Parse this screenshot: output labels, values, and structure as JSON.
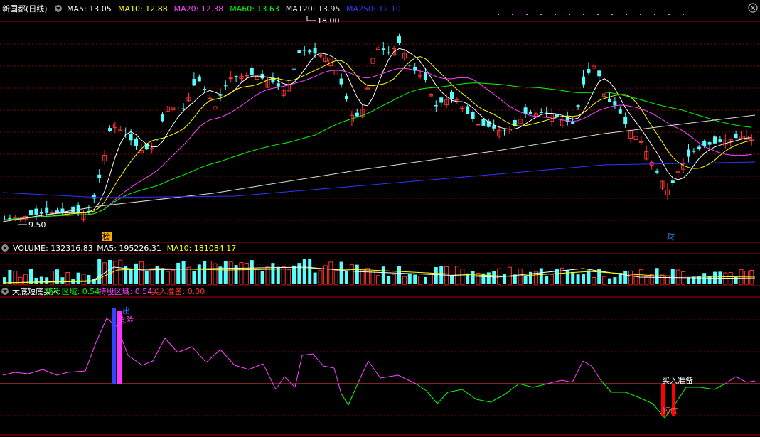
{
  "header": {
    "stock": "新国都(日线)",
    "ma_items": [
      {
        "label": "MA5: 13.05",
        "color": "#ffffff"
      },
      {
        "label": "MA10: 12.88",
        "color": "#ffff00"
      },
      {
        "label": "MA20: 12.38",
        "color": "#ff44ff"
      },
      {
        "label": "MA60: 13.63",
        "color": "#00ff00"
      },
      {
        "label": "MA120: 13.95",
        "color": "#dddddd"
      },
      {
        "label": "MA250: 12.10",
        "color": "#3333ff"
      }
    ]
  },
  "volume_header": {
    "items": [
      {
        "label": "VOLUME: 132316.83",
        "color": "#ffffff"
      },
      {
        "label": "MA5: 195226.31",
        "color": "#ffffff"
      },
      {
        "label": "MA10: 181084.17",
        "color": "#ffff00"
      }
    ]
  },
  "indicator_header": {
    "items": [
      {
        "label": "大底短底买入",
        "color": "#ffffff"
      },
      {
        "label": "持币区域: 0.54",
        "color": "#00ff00"
      },
      {
        "label": "持股区域: 0.54",
        "color": "#ff44ff"
      },
      {
        "label": "买入准备: 0.00",
        "color": "#ff3333"
      }
    ]
  },
  "chart_data": {
    "type": "candlestick",
    "price_high_label": "18.00",
    "price_low_label": "9.50",
    "markers": [
      {
        "text": "榜"
      },
      {
        "text": "财"
      }
    ],
    "signals": {
      "top_small": "出",
      "danger": "危险",
      "buy_ready": "买入准备",
      "buy_label": "短底"
    },
    "colors": {
      "up": "#ff3333",
      "down": "#54ffff",
      "grid": "#8b0000"
    }
  }
}
